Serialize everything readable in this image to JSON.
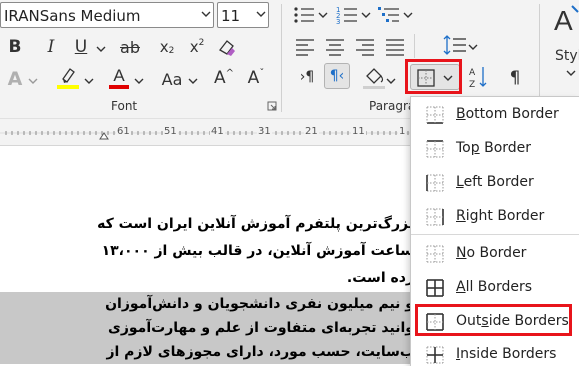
{
  "font_group": {
    "font_name": "IRANSans Medium",
    "font_size": "11",
    "label": "Font"
  },
  "paragraph_group": {
    "label": "Paragra"
  },
  "styles_group": {
    "label": "Styl"
  },
  "ruler": {
    "ticks": [
      "61",
      "51",
      "41",
      "31",
      "21",
      "11",
      "1"
    ]
  },
  "document": {
    "lines": [
      "بزرگ‌ترین پلتفرم آموزش آنلاین ایران است که",
      "ساعت آموزش آنلاین، در قالب بیش از ۱۳،۰۰۰",
      "رده است.",
      "و نیم میلیون نفری دانشجویان و دانش‌آموزان",
      "وانید تجربه‌ای متفاوت از علم و مهارت‌آموزی",
      "ب‌سایت، حسب مورد، دارای مجوزهای لازم از"
    ]
  },
  "border_menu": {
    "items": [
      {
        "label": "Bottom Border",
        "icon": "bottom-border-icon",
        "mnemonic": "B"
      },
      {
        "label": "Top Border",
        "icon": "top-border-icon",
        "mnemonic": "P"
      },
      {
        "label": "Left Border",
        "icon": "left-border-icon",
        "mnemonic": "L"
      },
      {
        "label": "Right Border",
        "icon": "right-border-icon",
        "mnemonic": "R"
      },
      {
        "label": "No Border",
        "icon": "no-border-icon",
        "mnemonic": "N"
      },
      {
        "label": "All Borders",
        "icon": "all-borders-icon",
        "mnemonic": "A"
      },
      {
        "label": "Outside Borders",
        "icon": "outside-borders-icon",
        "mnemonic": "S"
      },
      {
        "label": "Inside Borders",
        "icon": "inside-borders-icon",
        "mnemonic": "I"
      }
    ]
  },
  "colors": {
    "highlight_red": "#e8141b",
    "highlighter_yellow": "#ffff00",
    "font_color_red": "#e00000",
    "selection_gray": "#c8c8c8",
    "ribbon_bg": "#f3f3f3"
  }
}
